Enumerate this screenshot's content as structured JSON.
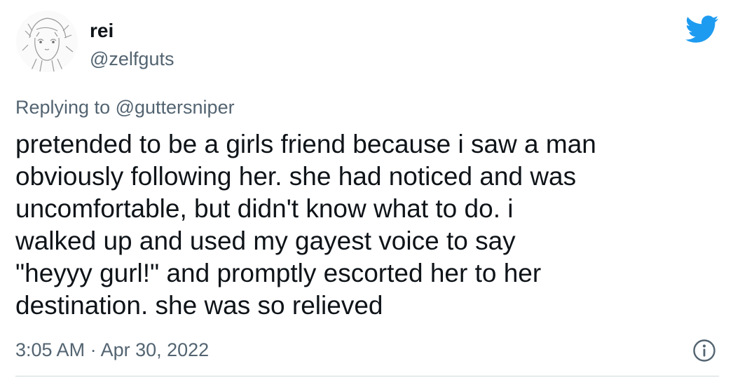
{
  "author": {
    "display_name": "rei",
    "handle": "@zelfguts",
    "avatar_icon": "avatar-sketch-icon"
  },
  "brand": {
    "icon": "twitter-bird-icon",
    "color": "#1d9bf0"
  },
  "reply": {
    "prefix": "Replying to ",
    "mention": "@guttersniper"
  },
  "tweet": {
    "lines": [
      "pretended to be a girls friend because i saw a man",
      "obviously following her. she had noticed and was",
      "uncomfortable, but didn't know what to do. i",
      "walked up and used my gayest voice to say",
      "\"heyyy gurl!\" and promptly escorted her to her",
      "destination. she was so relieved"
    ]
  },
  "meta": {
    "time": "3:05 AM",
    "separator": " · ",
    "date": "Apr 30, 2022",
    "info_icon": "info-icon"
  },
  "colors": {
    "text": "#0f1419",
    "secondary": "#536471",
    "accent": "#1d9bf0",
    "divider": "#cfd9de"
  }
}
